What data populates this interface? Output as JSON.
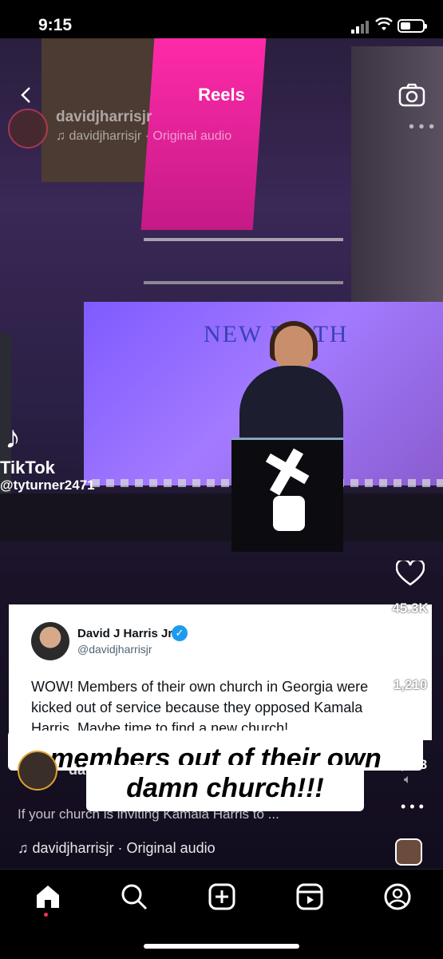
{
  "status_bar": {
    "time": "9:15"
  },
  "header": {
    "title": "Reels"
  },
  "top_post": {
    "username": "davidjharrisjr",
    "audio": "davidjharrisjr · Original audio"
  },
  "video": {
    "backdrop_text": "NEW BIRTH",
    "watermark_app": "TikTok",
    "watermark_user": "@tyturner2471"
  },
  "tweet": {
    "name": "David J Harris Jr",
    "handle": "@davidjharrisjr",
    "text": "WOW! Members of their own church in Georgia were kicked out of service because they opposed Kamala Harris. Maybe time to find a new church!"
  },
  "actions": {
    "likes": "45.3K",
    "comments": "1,210",
    "shares": "6,273"
  },
  "captions": {
    "line1": "members out of their own",
    "line2": "damn church!!!"
  },
  "post": {
    "username": "davidjharrisjr",
    "caption": "If your church is inviting Kamala Harris to ...",
    "audio": "davidjharrisjr · Original audio"
  },
  "nav": {
    "items": [
      "home-icon",
      "search-icon",
      "create-icon",
      "reels-icon",
      "profile-icon"
    ]
  },
  "colors": {
    "accent_pink": "#ff2aa9",
    "verified_blue": "#1d9bf0",
    "screen_purple": "#8a5cff"
  }
}
